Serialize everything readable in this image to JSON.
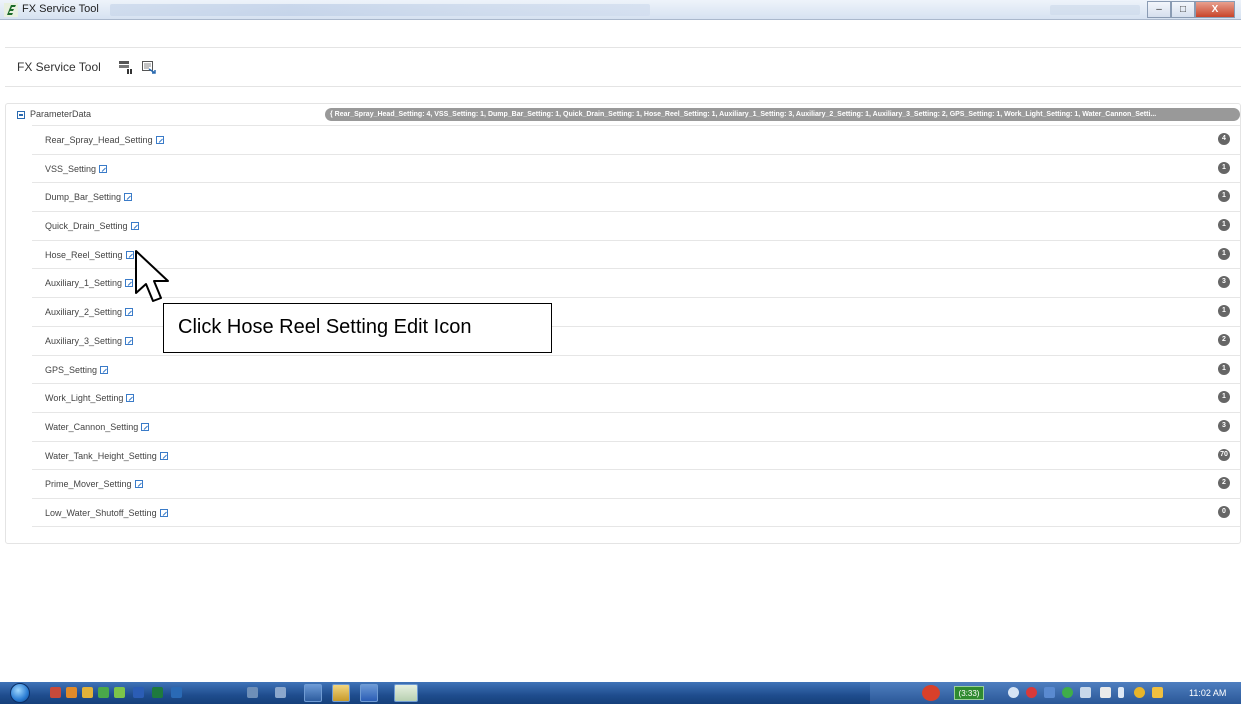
{
  "window": {
    "title": "FX Service Tool",
    "controls": {
      "minimize": "–",
      "maximize": "□",
      "close": "X"
    }
  },
  "header": {
    "app_name": "FX Service Tool",
    "icons": [
      "pause-icon",
      "export-icon"
    ]
  },
  "tree": {
    "root_label": "ParameterData",
    "root_summary": "{ Rear_Spray_Head_Setting: 4, VSS_Setting: 1, Dump_Bar_Setting: 1, Quick_Drain_Setting: 1, Hose_Reel_Setting: 1, Auxiliary_1_Setting: 3, Auxiliary_2_Setting: 1, Auxiliary_3_Setting: 2, GPS_Setting: 1, Work_Light_Setting: 1, Water_Cannon_Setti...",
    "items": [
      {
        "label": "Rear_Spray_Head_Setting",
        "count": "4"
      },
      {
        "label": "VSS_Setting",
        "count": "1"
      },
      {
        "label": "Dump_Bar_Setting",
        "count": "1"
      },
      {
        "label": "Quick_Drain_Setting",
        "count": "1"
      },
      {
        "label": "Hose_Reel_Setting",
        "count": "1"
      },
      {
        "label": "Auxiliary_1_Setting",
        "count": "3"
      },
      {
        "label": "Auxiliary_2_Setting",
        "count": "1"
      },
      {
        "label": "Auxiliary_3_Setting",
        "count": "2"
      },
      {
        "label": "GPS_Setting",
        "count": "1"
      },
      {
        "label": "Work_Light_Setting",
        "count": "1"
      },
      {
        "label": "Water_Cannon_Setting",
        "count": "3"
      },
      {
        "label": "Water_Tank_Height_Setting",
        "count": "70"
      },
      {
        "label": "Prime_Mover_Setting",
        "count": "2"
      },
      {
        "label": "Low_Water_Shutoff_Setting",
        "count": "0"
      }
    ]
  },
  "callout": {
    "text": "Click Hose Reel Setting Edit Icon"
  },
  "taskbar": {
    "tray_badge": "(3:33)",
    "clock": "11:02 AM"
  },
  "colors": {
    "badge_bg": "#666666",
    "summary_bg": "#999999",
    "edit_icon": "#3a7bc8",
    "taskbar": "#1f4d8e"
  }
}
